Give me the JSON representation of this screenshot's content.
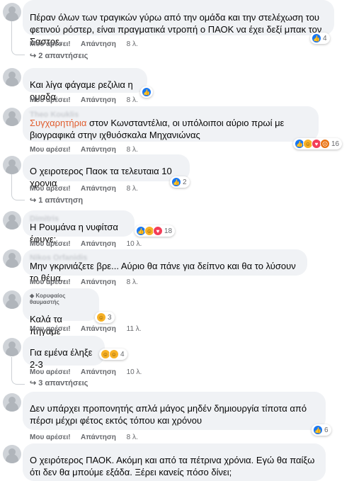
{
  "comments": [
    {
      "id": "c1",
      "name": "",
      "text": "Πέραν όλων των τραγικών γύρω από την ομάδα και την στελέχωση του φετινού ρόστερ, είναι πραγματικά ντροπή ο ΠΑΟΚ να έχει δεξί μπακ τον Σαστρε.",
      "like": "Μου αρέσει!",
      "reply": "Απάντηση",
      "time": "8 λ.",
      "reactions": "4",
      "replies": "2 απαντήσεις"
    },
    {
      "id": "c2",
      "name": "",
      "text": "Και λίγα φάγαμε ρεζιλια η ομαδα",
      "like": "Μου αρέσει!",
      "reply": "Απάντηση",
      "time": "8 λ."
    },
    {
      "id": "c3",
      "name": "Theo Kouklis",
      "highlight": "Συγχαρητήρια",
      "text": " στον Κωνσταντέλια, οι υπόλοιποι αύριο πρωί με βιογραφικά στην ιχθυόσκαλα Μηχανιώνας",
      "like": "Μου αρέσει!",
      "reply": "Απάντηση",
      "time": "8 λ.",
      "reactions": "16"
    },
    {
      "id": "c4",
      "name": "",
      "text": "Ο χειροτερος Παοκ τα τελευταια 10 χρονια",
      "like": "Μου αρέσει!",
      "reply": "Απάντηση",
      "time": "8 λ.",
      "reactions": "2",
      "replies": "1 απάντηση"
    },
    {
      "id": "c5",
      "name": "Dimitris",
      "text": "Η Ρουμάνα η νυφίτσα έφυγε;",
      "like": "Μου αρέσει!",
      "reply": "Απάντηση",
      "time": "10 λ.",
      "reactions": "18"
    },
    {
      "id": "c6",
      "name": "Nikos Orfanidis",
      "text": "Μην γκρινιάζετε βρε... Αύριο θα πάνε για δείπνο και θα το λύσουν το θέμα...",
      "like": "Μου αρέσει!",
      "reply": "Απάντηση",
      "time": "8 λ."
    },
    {
      "id": "c7",
      "badge": "Κορυφαίος θαυμαστής",
      "name": "",
      "text": "Καλά τα πήγαμε",
      "like": "Μου αρέσει!",
      "reply": "Απάντηση",
      "time": "11 λ.",
      "reactions": "3"
    },
    {
      "id": "c8",
      "name": "",
      "text": "Για εμένα έληξε 2-3",
      "like": "Μου αρέσει!",
      "reply": "Απάντηση",
      "time": "10 λ.",
      "reactions": "4",
      "replies": "3 απαντήσεις"
    },
    {
      "id": "c9",
      "name": "",
      "text": "Δεν υπάρχει προπονητής απλά μάγος μηδέν δημιουργία τίποτα από πέρσι μέχρι φέτος εκτός τόπου και χρόνου",
      "like": "Μου αρέσει!",
      "reply": "Απάντηση",
      "time": "8 λ.",
      "reactions": "6"
    },
    {
      "id": "c10",
      "name": "",
      "text": "Ο χειρότερος ΠΑΟΚ. Ακόμη και από τα πέτρινα χρόνια. Εγώ θα παίξω ότι δεν θα μπούμε εξάδα. Ξέρει κανείς πόσο δίνει;"
    }
  ],
  "icons": {
    "like": "like-icon",
    "haha": "haha-icon",
    "love": "love-icon",
    "angry": "angry-icon",
    "reply_arrow": "reply-arrow-icon",
    "badge": "diamond-icon"
  }
}
